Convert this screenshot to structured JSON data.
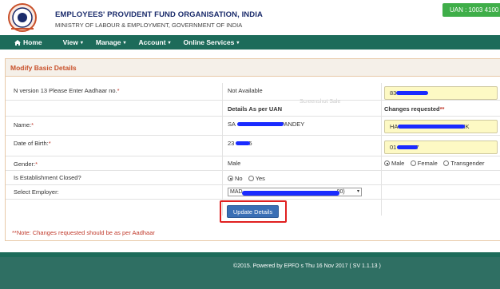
{
  "header": {
    "org_name": "EMPLOYEES' PROVIDENT FUND ORGANISATION, INDIA",
    "ministry": "MINISTRY OF LABOUR & EMPLOYMENT, GOVERNMENT OF INDIA",
    "uan_label": "UAN : 1003 4100"
  },
  "nav": {
    "items": [
      {
        "label": "Home",
        "icon": "home-icon"
      },
      {
        "label": "View"
      },
      {
        "label": "Manage"
      },
      {
        "label": "Account"
      },
      {
        "label": "Online Services"
      }
    ],
    "caret": "▾"
  },
  "panel": {
    "title": "Modify Basic Details",
    "watermark": "Screenshot Sale",
    "rows": {
      "aadhaar": {
        "label": "N version 13 Please Enter Aadhaar no.",
        "star": "*",
        "current": "Not Available",
        "requested": "83"
      },
      "headers": {
        "current": "Details As per UAN",
        "requested": "Changes requested",
        "requested_star": "**"
      },
      "name": {
        "label": "Name:",
        "star": "*",
        "current": "SA",
        "current_tail": "PANDEY",
        "requested": "HA",
        "requested_tail": "IK"
      },
      "dob": {
        "label": "Date of Birth:",
        "star": "*",
        "current": "23",
        "current_tail": "5",
        "requested": "01",
        "requested_tail": "7"
      },
      "gender": {
        "label": "Gender:",
        "star": "*",
        "current": "Male",
        "options": [
          "Male",
          "Female",
          "Transgender"
        ],
        "selected": "Male"
      },
      "establishment": {
        "label": "Is Establishment Closed?",
        "options": [
          "No",
          "Yes"
        ],
        "selected": "No"
      },
      "employer": {
        "label": "Select Employer:",
        "value": "MAD",
        "value_tail": "00)"
      }
    },
    "update_button": "Update Details",
    "note": "**Note: Changes requested should be as per Aadhaar"
  },
  "footer": {
    "text": "©2015. Powered by EPFO s Thu 16 Nov 2017 ( SV 1.1.13 )"
  },
  "colors": {
    "nav_bg": "#1d6b5a",
    "uan_bg": "#3fae49",
    "heading_text": "#c8502a",
    "input_yellow": "#fdf9c4",
    "button_blue": "#3a6fb5",
    "highlight_red": "#e02020",
    "redaction_blue": "#1a2bff"
  }
}
